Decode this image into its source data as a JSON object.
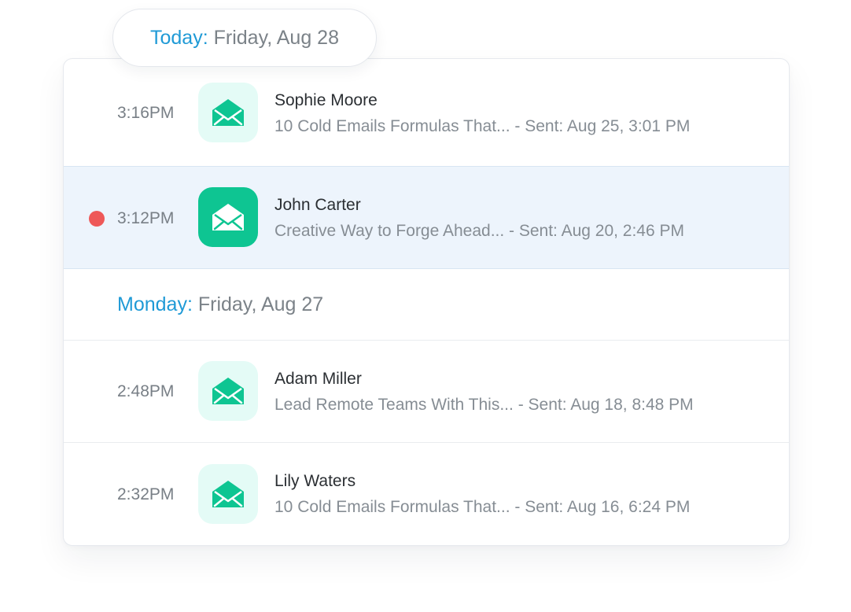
{
  "today_header": {
    "label": "Today:",
    "date": "Friday, Aug 28"
  },
  "monday_header": {
    "label": "Monday:",
    "date": "Friday, Aug 27"
  },
  "colors": {
    "accent_blue": "#1f9ad6",
    "green": "#0ec592",
    "green_light": "#e4fbf6",
    "unread_dot": "#ee5858",
    "active_row": "#edf4fc"
  },
  "rows": [
    {
      "time": "3:16PM",
      "name": "Sophie Moore",
      "preview": "10 Cold Emails Formulas That... - Sent: Aug 25, 3:01 PM",
      "icon": "mail-open-icon"
    },
    {
      "time": "3:12PM",
      "name": "John Carter",
      "preview": "Creative Way to Forge Ahead... - Sent: Aug 20, 2:46 PM",
      "icon": "mail-open-icon",
      "unread": true,
      "active": true
    },
    {
      "time": "2:48PM",
      "name": "Adam Miller",
      "preview": "Lead Remote Teams With This... - Sent: Aug 18, 8:48 PM",
      "icon": "mail-open-icon"
    },
    {
      "time": "2:32PM",
      "name": "Lily Waters",
      "preview": "10 Cold Emails Formulas That... - Sent: Aug 16, 6:24 PM",
      "icon": "mail-open-icon"
    }
  ]
}
